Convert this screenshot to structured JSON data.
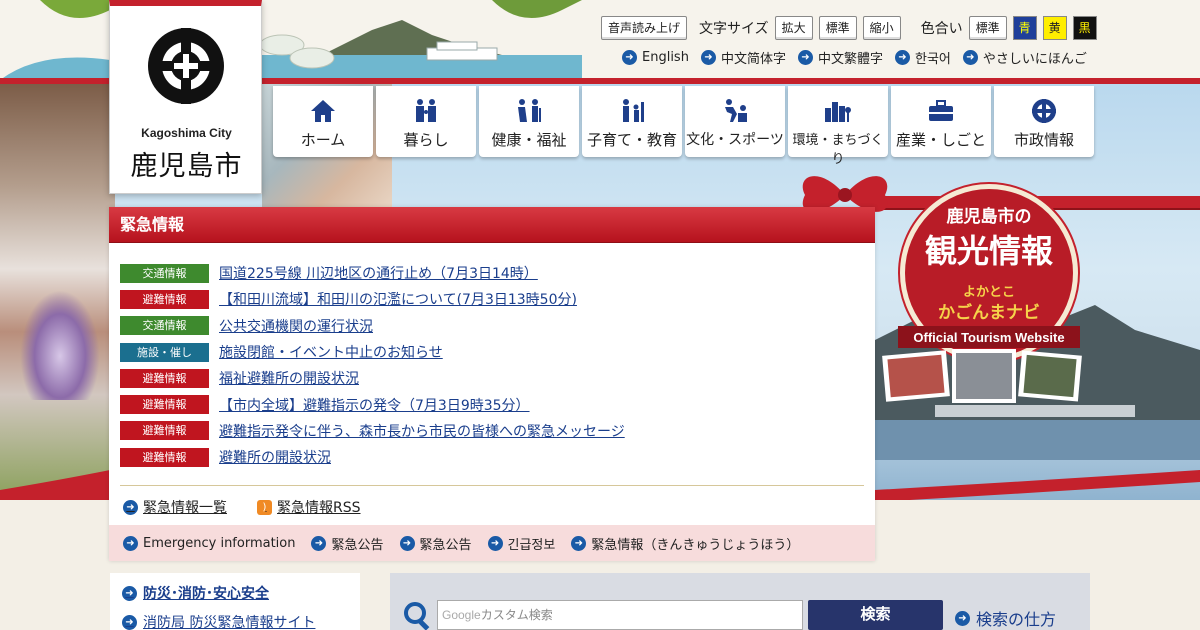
{
  "header": {
    "logo": {
      "en": "Kagoshima City",
      "ja": "鹿児島市"
    },
    "toolbar": {
      "read_aloud": "音声読み上げ",
      "font_size_label": "文字サイズ",
      "font_size_options": [
        "拡大",
        "標準",
        "縮小"
      ],
      "color_label": "色合い",
      "color_options": [
        {
          "label": "標準",
          "bg": "#ffffff",
          "fg": "#222222"
        },
        {
          "label": "青",
          "bg": "#1f3f9a",
          "fg": "#ffff00"
        },
        {
          "label": "黄",
          "bg": "#ffee00",
          "fg": "#222222"
        },
        {
          "label": "黒",
          "bg": "#111111",
          "fg": "#ffee00"
        }
      ]
    },
    "languages": [
      "English",
      "中文简体字",
      "中文繁體字",
      "한국어",
      "やさしいにほんご"
    ]
  },
  "nav": [
    {
      "label": "ホーム",
      "icon": "home-icon"
    },
    {
      "label": "暮らし",
      "icon": "family-icon"
    },
    {
      "label": "健康・福祉",
      "icon": "welfare-icon"
    },
    {
      "label": "子育て・教育",
      "icon": "parenting-icon"
    },
    {
      "label": "文化・スポーツ",
      "icon": "sports-icon"
    },
    {
      "label": "環境・まちづくり",
      "icon": "city-icon"
    },
    {
      "label": "産業・しごと",
      "icon": "briefcase-icon"
    },
    {
      "label": "市政情報",
      "icon": "city-emblem-icon"
    }
  ],
  "emergency": {
    "title": "緊急情報",
    "items": [
      {
        "category": "交通情報",
        "color": "#3e8a2e",
        "text": "国道225号線 川辺地区の通行止め（7月3日14時）"
      },
      {
        "category": "避難情報",
        "color": "#c0151f",
        "text": "【和田川流域】和田川の氾濫について(7月3日13時50分)"
      },
      {
        "category": "交通情報",
        "color": "#3e8a2e",
        "text": "公共交通機関の運行状況"
      },
      {
        "category": "施設・催し",
        "color": "#1b6f8f",
        "text": "施設閉館・イベント中止のお知らせ"
      },
      {
        "category": "避難情報",
        "color": "#c0151f",
        "text": "福祉避難所の開設状況"
      },
      {
        "category": "避難情報",
        "color": "#c0151f",
        "text": "【市内全域】避難指示の発令（7月3日9時35分）"
      },
      {
        "category": "避難情報",
        "color": "#c0151f",
        "text": "避難指示発令に伴う、森市長から市民の皆様への緊急メッセージ"
      },
      {
        "category": "避難情報",
        "color": "#c0151f",
        "text": "避難所の開設状況"
      }
    ],
    "list_link": "緊急情報一覧",
    "rss_link": "緊急情報RSS",
    "multilingual": [
      "Emergency information",
      "緊急公告",
      "緊急公告",
      "긴급정보",
      "緊急情報（きんきゅうじょうほう）"
    ]
  },
  "tourism": {
    "top": "鹿児島市の",
    "main": "観光情報",
    "sub1": "よかとこ",
    "sub2": "かごんまナビ",
    "en": "Official Tourism Website"
  },
  "bottom": {
    "side_links": [
      "防災･消防･安心安全",
      "消防局 防災緊急情報サイト"
    ],
    "search": {
      "google": "Google",
      "placeholder": "カスタム検索",
      "button": "検索",
      "help": "検索の仕方"
    }
  }
}
